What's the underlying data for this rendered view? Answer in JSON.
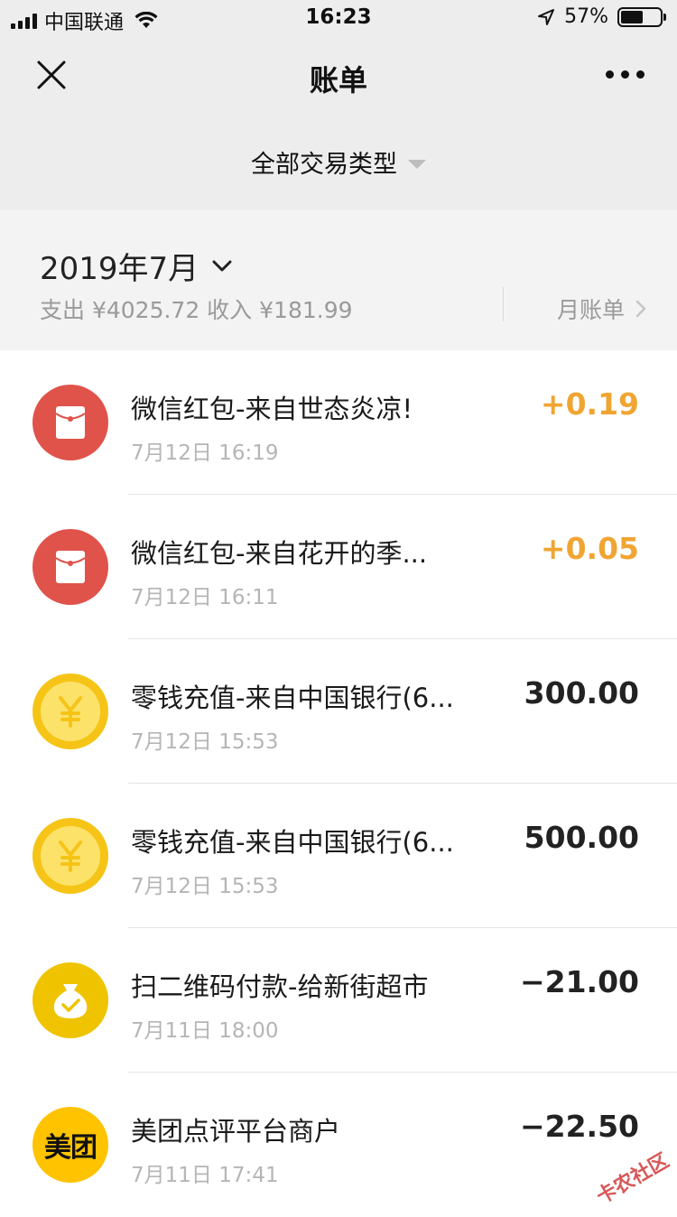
{
  "status_bar": {
    "carrier": "中国联通",
    "time": "16:23",
    "battery": "57%"
  },
  "nav": {
    "title": "账单"
  },
  "filter": {
    "label": "全部交易类型"
  },
  "month": {
    "title": "2019年7月",
    "summary": "支出 ¥4025.72 收入 ¥181.99",
    "bill_link": "月账单"
  },
  "transactions": [
    {
      "title": "微信红包-来自世态炎凉!",
      "time": "7月12日 16:19",
      "amount": "+0.19",
      "icon": "red-packet-icon"
    },
    {
      "title": "微信红包-来自花开的季...",
      "time": "7月12日 16:11",
      "amount": "+0.05",
      "icon": "red-packet-icon"
    },
    {
      "title": "零钱充值-来自中国银行(6...",
      "time": "7月12日 15:53",
      "amount": "300.00",
      "icon": "yuan-coin-icon"
    },
    {
      "title": "零钱充值-来自中国银行(6...",
      "time": "7月12日 15:53",
      "amount": "500.00",
      "icon": "yuan-coin-icon"
    },
    {
      "title": "扫二维码付款-给新街超市",
      "time": "7月11日 18:00",
      "amount": "−21.00",
      "icon": "money-bag-icon"
    },
    {
      "title": "美团点评平台商户",
      "time": "7月11日 17:41",
      "amount": "−22.50",
      "icon": "meituan-logo-icon",
      "logo_text": "美团"
    }
  ],
  "colors": {
    "income": "#f0a532",
    "red_packet": "#e0534a",
    "coin": "#f5c417"
  },
  "watermark": "卡农社区"
}
